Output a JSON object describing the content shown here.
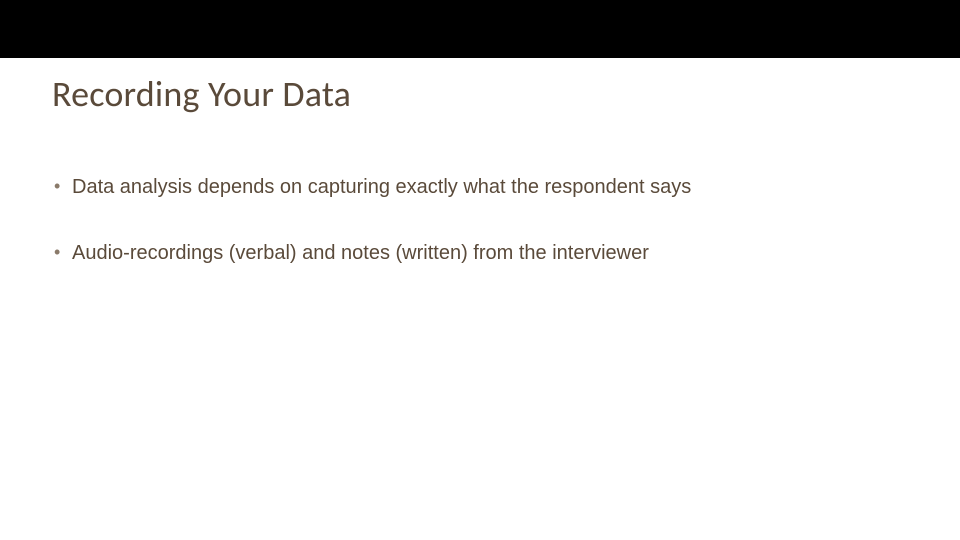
{
  "slide": {
    "title": "Recording Your Data",
    "bullets": [
      "Data analysis depends on capturing exactly what the respondent says",
      "Audio-recordings (verbal) and notes (written) from the interviewer"
    ]
  }
}
